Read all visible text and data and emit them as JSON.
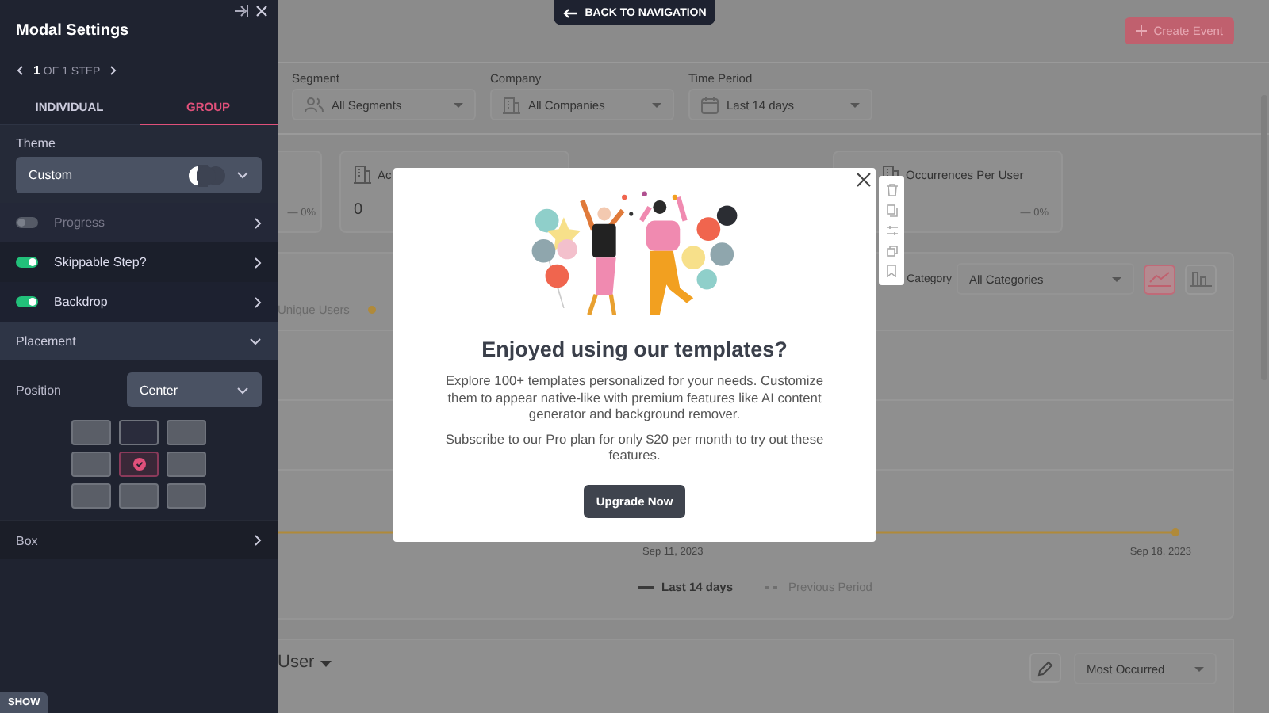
{
  "sidebar": {
    "title": "Modal Settings",
    "step": "**1** OF 1 STEP",
    "tabs": [
      {
        "label": "INDIVIDUAL",
        "selected": false
      },
      {
        "label": "GROUP",
        "selected": true
      }
    ],
    "theme": {
      "label": "Theme",
      "value": "Custom"
    },
    "toggles": [
      {
        "label": "Progress",
        "on": false,
        "disabled": true
      },
      {
        "label": "Skippable Step?",
        "on": true,
        "disabled": false
      },
      {
        "label": "Backdrop",
        "on": true,
        "disabled": false
      }
    ],
    "placement": {
      "label": "Placement",
      "expanded": true,
      "position_label": "Position",
      "position_value": "Center",
      "grid": [
        {
          "selected": false,
          "highlighted": false
        },
        {
          "selected": false,
          "highlighted": true
        },
        {
          "selected": false,
          "highlighted": false
        },
        {
          "selected": false,
          "highlighted": false
        },
        {
          "selected": true,
          "highlighted": false
        },
        {
          "selected": false,
          "highlighted": false
        },
        {
          "selected": false,
          "highlighted": false
        },
        {
          "selected": false,
          "highlighted": false
        },
        {
          "selected": false,
          "highlighted": false
        }
      ]
    },
    "box": {
      "label": "Box"
    },
    "show_button": "SHOW"
  },
  "back_button": "BACK TO NAVIGATION",
  "dashboard": {
    "create_button": "Create Event",
    "filters": [
      {
        "label": "Segment",
        "value": "All Segments",
        "kind": "people"
      },
      {
        "label": "Company",
        "value": "All Companies",
        "kind": "building"
      },
      {
        "label": "Time Period",
        "value": "Last 14 days",
        "kind": "calendar"
      }
    ],
    "cards": [
      {
        "change": "— 0%"
      },
      {
        "title": "Ac",
        "value": "0"
      },
      {
        "title": "Occurrences Per User",
        "change": "— 0%"
      }
    ],
    "chart": {
      "category_label": "Category",
      "category_value": "All Categories",
      "legend_top": [
        "Unique Users"
      ],
      "x_labels": [
        "Sep 11, 2023",
        "Sep 18, 2023"
      ],
      "legend_bottom": [
        {
          "label": "Last 14 days",
          "kind": "solid"
        },
        {
          "label": "Previous Period",
          "kind": "dashed"
        }
      ]
    },
    "bottom": {
      "title": "User",
      "sort_value": "Most Occurred"
    }
  },
  "modal": {
    "heading": "Enjoyed using our templates?",
    "paragraphs": [
      "Explore 100+ templates personalized for your needs. Customize them to appear native-like with premium features like AI content generator and background remover.",
      "Subscribe to our Pro plan for only $20 per month to try out these features."
    ],
    "button": "Upgrade Now"
  }
}
